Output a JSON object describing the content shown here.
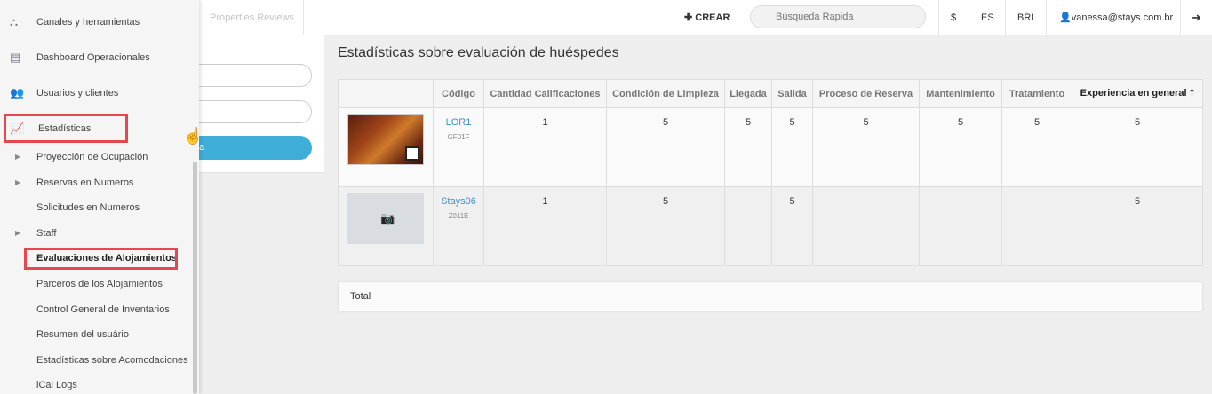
{
  "topbar": {
    "reviews_tab": "Properties Reviews",
    "crear_label": "CREAR",
    "search_placeholder": "Búsqueda Rapida",
    "currency_symbol": "$",
    "language": "ES",
    "currency": "BRL",
    "user_email": "vanessa@stays.com.br"
  },
  "left_panel": {
    "button_label": "a"
  },
  "sidebar": {
    "top_items": [
      {
        "label": "Canales y herramientas",
        "icon": "sitemap-icon"
      },
      {
        "label": "Dashboard Operacionales",
        "icon": "dashboard-icon"
      },
      {
        "label": "Usuarios y clientes",
        "icon": "users-icon"
      },
      {
        "label": "Estadísticas",
        "icon": "chart-line-icon"
      }
    ],
    "sub_items": [
      {
        "label": "Proyección de Ocupación",
        "has_caret": true
      },
      {
        "label": "Reservas en Numeros",
        "has_caret": true
      },
      {
        "label": "Solicitudes en Numeros",
        "has_caret": false
      },
      {
        "label": "Staff",
        "has_caret": true
      },
      {
        "label": "Evaluaciones de Alojamientos",
        "has_caret": false
      },
      {
        "label": "Parceros de los Alojamientos",
        "has_caret": false
      },
      {
        "label": "Control General de Inventarios",
        "has_caret": false
      },
      {
        "label": "Resumen del usuário",
        "has_caret": false
      },
      {
        "label": "Estadísticas sobre Acomodaciones",
        "has_caret": false
      },
      {
        "label": "iCal Logs",
        "has_caret": false
      }
    ]
  },
  "main": {
    "title": "Estadísticas sobre evaluación de huéspedes",
    "columns": [
      "",
      "Código",
      "Cantidad Calificaciones",
      "Condición de Limpieza",
      "Llegada",
      "Salida",
      "Proceso de Reserva",
      "Mantenimiento",
      "Tratamiento",
      "Experiencia en general"
    ],
    "rows": [
      {
        "code": "LOR1",
        "sub": "GF01F",
        "values": [
          "1",
          "5",
          "5",
          "5",
          "5",
          "5",
          "5",
          "5"
        ]
      },
      {
        "code": "Stays06",
        "sub": "Z011E",
        "values": [
          "1",
          "5",
          "",
          "5",
          "",
          "",
          "",
          "5"
        ]
      }
    ],
    "total_label": "Total"
  },
  "colors": {
    "accent": "#3eaed8",
    "highlight": "#e6464d",
    "link": "#3d8fc9"
  }
}
